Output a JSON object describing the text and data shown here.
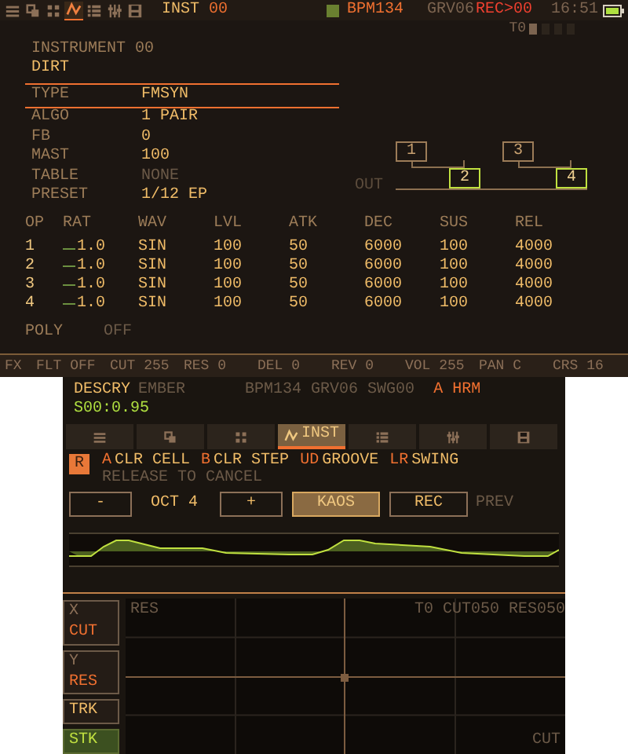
{
  "status_bar": {
    "tabs": [
      {
        "kind": "menu",
        "selected": false
      },
      {
        "kind": "copy",
        "selected": false
      },
      {
        "kind": "grid",
        "selected": false
      },
      {
        "kind": "wave",
        "selected": true
      },
      {
        "kind": "list",
        "selected": false
      },
      {
        "kind": "mixer",
        "selected": false
      },
      {
        "kind": "save",
        "selected": false
      }
    ],
    "screen_label": "INST",
    "screen_number": "00",
    "bpm": "BPM134",
    "groove": "GRV06",
    "rec": "REC>00",
    "time": "16:51",
    "track": "T0",
    "track_slots": [
      {
        "active": true
      },
      {
        "active": false
      },
      {
        "active": false
      },
      {
        "active": false
      }
    ]
  },
  "instrument": {
    "title": "INSTRUMENT 00",
    "name": "DIRT",
    "params": [
      {
        "label": "TYPE",
        "value": "FMSYN",
        "selected": true,
        "disabled": false
      },
      {
        "label": "ALGO",
        "value": "1 PAIR",
        "selected": false,
        "disabled": false
      },
      {
        "label": "FB",
        "value": "0",
        "selected": false,
        "disabled": false
      },
      {
        "label": "MAST",
        "value": "100",
        "selected": false,
        "disabled": false
      },
      {
        "label": "TABLE",
        "value": "NONE",
        "selected": false,
        "disabled": true
      },
      {
        "label": "PRESET",
        "value": "1/12 EP",
        "selected": false,
        "disabled": false
      }
    ]
  },
  "algorithm": {
    "out_label": "OUT",
    "operators": [
      {
        "label": "1",
        "carrier": false
      },
      {
        "label": "2",
        "carrier": true
      },
      {
        "label": "3",
        "carrier": false
      },
      {
        "label": "4",
        "carrier": true
      }
    ]
  },
  "operators": {
    "columns": [
      "OP",
      "RAT",
      "WAV",
      "LVL",
      "ATK",
      "DEC",
      "SUS",
      "REL"
    ],
    "rows": [
      [
        "1",
        "1.0",
        "SIN",
        "100",
        "50",
        "6000",
        "100",
        "4000"
      ],
      [
        "2",
        "1.0",
        "SIN",
        "100",
        "50",
        "6000",
        "100",
        "4000"
      ],
      [
        "3",
        "1.0",
        "SIN",
        "100",
        "50",
        "6000",
        "100",
        "4000"
      ],
      [
        "4",
        "1.0",
        "SIN",
        "100",
        "50",
        "6000",
        "100",
        "4000"
      ]
    ]
  },
  "poly": {
    "label": "POLY",
    "value": "OFF"
  },
  "fx_bar": [
    "FX",
    "FLT OFF",
    "CUT 255",
    "RES 0",
    "DEL 0",
    "REV 0",
    "VOL 255",
    "PAN C",
    "CRS 16"
  ],
  "song": {
    "name": "DESCRY",
    "subname": "EMBER",
    "info": "BPM134 GRV06 SWG00",
    "mode": "A HRM",
    "position": "S00:0.95"
  },
  "tabs": [
    {
      "kind": "menu",
      "selected": false
    },
    {
      "kind": "copy",
      "selected": false
    },
    {
      "kind": "grid",
      "selected": false
    },
    {
      "kind": "wave",
      "label": "INST",
      "selected": true
    },
    {
      "kind": "list",
      "selected": false
    },
    {
      "kind": "mixer",
      "selected": false
    },
    {
      "kind": "save",
      "selected": false
    }
  ],
  "hold_key": "R",
  "hints": [
    {
      "key": "A",
      "action": "CLR CELL"
    },
    {
      "key": "B",
      "action": "CLR STEP"
    },
    {
      "key": "UD",
      "action": "GROOVE"
    },
    {
      "key": "LR",
      "action": "SWING"
    }
  ],
  "hold_hint": "RELEASE TO CANCEL",
  "controls": {
    "minus": "-",
    "octave": "OCT 4",
    "plus": "+",
    "kaos": {
      "label": "KAOS",
      "on": true
    },
    "rec": {
      "label": "REC",
      "on": false
    },
    "prev": "PREV"
  },
  "xy_pad": {
    "axes": [
      {
        "axis": "X",
        "param": "CUT"
      },
      {
        "axis": "Y",
        "param": "RES"
      }
    ],
    "modes": [
      {
        "label": "TRK",
        "selected": false
      },
      {
        "label": "STK",
        "selected": true
      }
    ],
    "y_label": "RES",
    "x_label": "CUT",
    "readout": "T0 CUT050 RES050"
  }
}
